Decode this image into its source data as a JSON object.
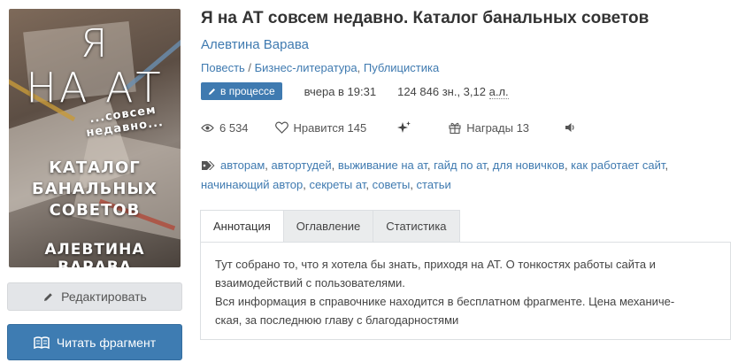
{
  "cover": {
    "line1": "Я",
    "line2": "НА АТ",
    "line3": "...совсем недавно...",
    "line4a": "КАТАЛОГ",
    "line4b": "БАНАЛЬНЫХ СОВЕТОВ",
    "line5": "АЛЕВТИНА ВАРАВА"
  },
  "buttons": {
    "edit": "Редактировать",
    "read": "Читать фрагмент"
  },
  "book": {
    "title": "Я на АТ совсем недавно. Каталог банальных советов",
    "author": "Алевтина Варава",
    "genres": [
      "Повесть",
      "Бизнес-литература",
      "Публицистика"
    ]
  },
  "meta": {
    "status": "в процессе",
    "updated": "вчера в 19:31",
    "chars": "124 846 зн., 3,12",
    "al": "а.л."
  },
  "stats": {
    "views": "6 534",
    "likes": "Нравится 145",
    "awards": "Награды 13"
  },
  "tags": [
    "авторам",
    "автортудей",
    "выживание на ат",
    "гайд по ат",
    "для новичков",
    "как работает сайт",
    "начинающий автор",
    "секреты ат",
    "советы",
    "статьи"
  ],
  "tabs": [
    "Аннотация",
    "Оглавление",
    "Статистика"
  ],
  "annotation": {
    "line1": "Тут собрано то, что я хотела бы знать, приходя на АТ. О тонкостях работы сайта и",
    "line2": "взаимодействий с пользователями.",
    "line3": "Вся информация в справочнике находится в бесплатном фрагменте. Цена механиче-",
    "line4": "ская, за последнюю главу с благодарностями"
  },
  "colors": {
    "accent": "#3f7ab0",
    "read_button": "#3e7cb2",
    "edit_button": "#e3e5e8"
  }
}
